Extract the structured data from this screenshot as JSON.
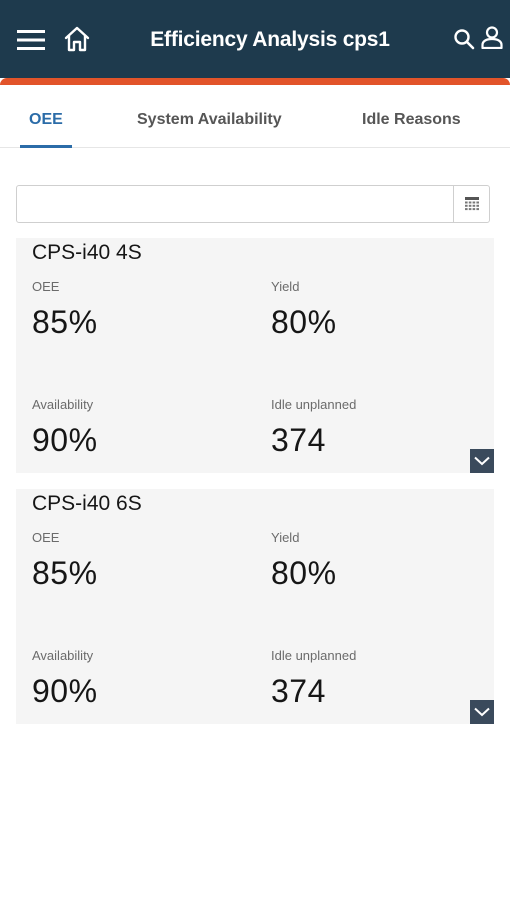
{
  "header": {
    "title": "Efficiency Analysis cps1",
    "icons": [
      "menu-icon",
      "home-icon",
      "search-icon",
      "user-icon"
    ],
    "background_color": "#1e3a4d",
    "accent_color": "#e2542a"
  },
  "tabs": [
    {
      "label": "OEE",
      "active": true
    },
    {
      "label": "System Availability",
      "active": false
    },
    {
      "label": "Idle Reasons",
      "active": false
    }
  ],
  "date_filter": {
    "value": "",
    "placeholder": "",
    "icon": "calendar-icon"
  },
  "cards": [
    {
      "title": "CPS-i40 4S",
      "oee_label": "OEE",
      "oee_value": "85%",
      "yield_label": "Yield",
      "yield_value": "80%",
      "availability_label": "Availability",
      "availability_value": "90%",
      "idle_label": "Idle unplanned",
      "idle_value": "374",
      "expand_icon": "chevron-down-icon"
    },
    {
      "title": "CPS-i40 6S",
      "oee_label": "OEE",
      "oee_value": "85%",
      "yield_label": "Yield",
      "yield_value": "80%",
      "availability_label": "Availability",
      "availability_value": "90%",
      "idle_label": "Idle unplanned",
      "idle_value": "374",
      "expand_icon": "chevron-down-icon"
    }
  ]
}
